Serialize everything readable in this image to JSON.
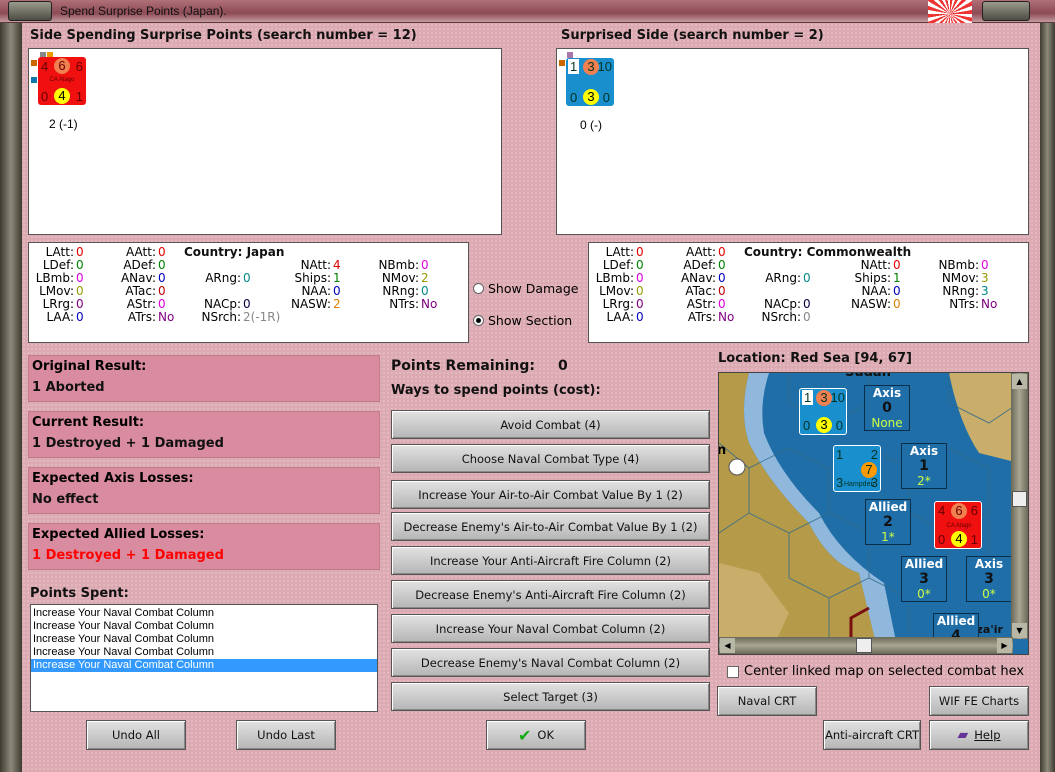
{
  "window": {
    "title": "Spend Surprise Points (Japan)."
  },
  "left_panel": {
    "title": "Side Spending Surprise Points (search number = 12)",
    "counter": {
      "top": [
        "4",
        "6",
        "6"
      ],
      "name": "CA Atago",
      "bottom": [
        "0",
        "4",
        "1"
      ],
      "caption": "2 (-1)"
    }
  },
  "right_panel": {
    "title": "Surprised Side (search number = 2)",
    "counter": {
      "top": [
        "1",
        "3",
        "10"
      ],
      "bottom": [
        "0",
        "3",
        "0"
      ],
      "caption": "0 (-)"
    }
  },
  "stats_japan": {
    "country": "Country: Japan",
    "rows": [
      [
        [
          "LAtt:",
          "0",
          "#e00000"
        ],
        [
          "AAtt:",
          "0",
          "#e00000"
        ],
        null,
        null,
        null
      ],
      [
        [
          "LDef:",
          "0",
          "#008000"
        ],
        [
          "ADef:",
          "0",
          "#008000"
        ],
        null,
        [
          "NAtt:",
          "4",
          "#e00000"
        ],
        [
          "NBmb:",
          "0",
          "#e000e0"
        ]
      ],
      [
        [
          "LBmb:",
          "0",
          "#e000e0"
        ],
        [
          "ANav:",
          "0",
          "#0000c0"
        ],
        [
          "ARng:",
          "0",
          "#008888"
        ],
        [
          "Ships:",
          "1",
          "#008000"
        ],
        [
          "NMov:",
          "2",
          "#999900"
        ]
      ],
      [
        [
          "LMov:",
          "0",
          "#999900"
        ],
        [
          "ATac:",
          "0",
          "#c00000"
        ],
        null,
        [
          "NAA:",
          "0",
          "#0000c0"
        ],
        [
          "NRng:",
          "0",
          "#008888"
        ]
      ],
      [
        [
          "LRrg:",
          "0",
          "#800080"
        ],
        [
          "AStr:",
          "0",
          "#e000e0"
        ],
        [
          "NACp:",
          "0",
          "#000040"
        ],
        [
          "NASW:",
          "2",
          "#e08000"
        ],
        [
          "NTrs:",
          "No",
          "#800080"
        ]
      ],
      [
        [
          "LAA:",
          "0",
          "#0000c0"
        ],
        [
          "ATrs:",
          "No",
          "#800080"
        ],
        [
          "NSrch:",
          "2(-1R)",
          "#888888"
        ],
        null,
        null
      ]
    ]
  },
  "stats_commonwealth": {
    "country": "Country: Commonwealth",
    "rows": [
      [
        [
          "LAtt:",
          "0",
          "#e00000"
        ],
        [
          "AAtt:",
          "0",
          "#e00000"
        ],
        null,
        null,
        null
      ],
      [
        [
          "LDef:",
          "0",
          "#008000"
        ],
        [
          "ADef:",
          "0",
          "#008000"
        ],
        null,
        [
          "NAtt:",
          "0",
          "#e00000"
        ],
        [
          "NBmb:",
          "0",
          "#e000e0"
        ]
      ],
      [
        [
          "LBmb:",
          "0",
          "#e000e0"
        ],
        [
          "ANav:",
          "0",
          "#0000c0"
        ],
        [
          "ARng:",
          "0",
          "#008888"
        ],
        [
          "Ships:",
          "1",
          "#008000"
        ],
        [
          "NMov:",
          "3",
          "#999900"
        ]
      ],
      [
        [
          "LMov:",
          "0",
          "#999900"
        ],
        [
          "ATac:",
          "0",
          "#c00000"
        ],
        null,
        [
          "NAA:",
          "0",
          "#0000c0"
        ],
        [
          "NRng:",
          "3",
          "#008888"
        ]
      ],
      [
        [
          "LRrg:",
          "0",
          "#800080"
        ],
        [
          "AStr:",
          "0",
          "#e000e0"
        ],
        [
          "NACp:",
          "0",
          "#000040"
        ],
        [
          "NASW:",
          "0",
          "#e08000"
        ],
        [
          "NTrs:",
          "No",
          "#800080"
        ]
      ],
      [
        [
          "LAA:",
          "0",
          "#0000c0"
        ],
        [
          "ATrs:",
          "No",
          "#800080"
        ],
        [
          "NSrch:",
          "0",
          "#888888"
        ],
        null,
        null
      ]
    ]
  },
  "view_options": {
    "show_damage": "Show Damage",
    "show_section": "Show Section",
    "selected": "show_section"
  },
  "results": [
    {
      "label": "Original Result:",
      "value": "1 Aborted",
      "color": "#111111"
    },
    {
      "label": "Current Result:",
      "value": "1 Destroyed + 1 Damaged",
      "color": "#111111"
    },
    {
      "label": "Expected Axis Losses:",
      "value": "No effect",
      "color": "#111111"
    },
    {
      "label": "Expected Allied Losses:",
      "value": "1 Destroyed + 1 Damaged",
      "color": "#ff0000"
    }
  ],
  "points_spent": {
    "label": "Points Spent:",
    "items": [
      "Increase Your Naval Combat Column",
      "Increase Your Naval Combat Column",
      "Increase Your Naval Combat Column",
      "Increase Your Naval Combat Column",
      "Increase Your Naval Combat Column"
    ],
    "selected_index": 4
  },
  "points_remaining": {
    "label": "Points Remaining:",
    "value": "0"
  },
  "ways_label": "Ways to spend points (cost):",
  "ways": [
    "Avoid Combat (4)",
    "Choose Naval Combat Type (4)",
    "Increase Your Air-to-Air Combat Value By 1 (2)",
    "Decrease Enemy's Air-to-Air Combat Value By 1 (2)",
    "Increase Your Anti-Aircraft Fire Column (2)",
    "Decrease Enemy's Anti-Aircraft Fire Column (2)",
    "Increase Your Naval Combat Column (2)",
    "Decrease Enemy's Naval Combat Column (2)",
    "Select Target (3)"
  ],
  "map": {
    "location": "Location: Red Sea [94, 67]",
    "zones": [
      {
        "side": "Axis",
        "num": "0",
        "sub": "None"
      },
      {
        "side": "Axis",
        "num": "1",
        "sub": "2*"
      },
      {
        "side": "Allied",
        "num": "2",
        "sub": "1*"
      },
      {
        "side": "Allied",
        "num": "3",
        "sub": "0*"
      },
      {
        "side": "Axis",
        "num": "3",
        "sub": "0*"
      },
      {
        "side": "Allied",
        "num": "4",
        "sub": ""
      }
    ],
    "labels": {
      "north": "Sudan",
      "place": "Jaza'ir",
      "west": "n"
    },
    "units": {
      "cw_ship": {
        "top": [
          "1",
          "3",
          "10"
        ],
        "bottom": [
          "0",
          "3",
          "0"
        ]
      },
      "hampden": {
        "top": [
          "1",
          "2"
        ],
        "factor": "7",
        "bottom": [
          "3",
          "3"
        ],
        "name": "Hampden"
      },
      "atago": {
        "top": [
          "4",
          "6",
          "6"
        ],
        "name": "CA Atago",
        "bottom": [
          "0",
          "4",
          "1"
        ]
      }
    },
    "scroll_v": 0.45,
    "scroll_h": 0.5
  },
  "center_map": {
    "label": "Center linked map on selected combat hex",
    "checked": false
  },
  "buttons": {
    "naval_crt": "Naval CRT",
    "wif_fe_charts": "WIF FE Charts",
    "aa_crt": "Anti-aircraft CRT",
    "help": "Help",
    "undo_all": "Undo All",
    "undo_last": "Undo Last",
    "ok": "OK"
  }
}
